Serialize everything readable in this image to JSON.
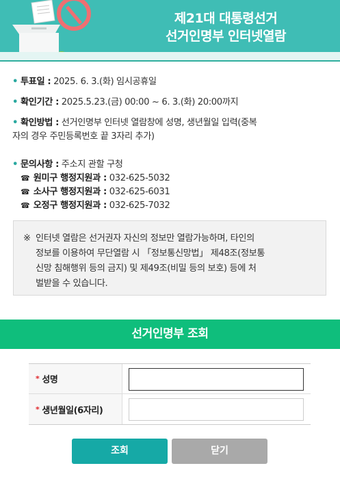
{
  "header": {
    "title_line1": "제21대 대통령선거",
    "title_line2": "선거인명부 인터넷열람",
    "colors": {
      "banner": "#3fbdb5",
      "accent": "#2aa9a0"
    }
  },
  "info": {
    "vote_day": {
      "label": "투표일 :",
      "value": "2025. 6. 3.(화) 임시공휴일"
    },
    "check_period": {
      "label": "확인기간 :",
      "value": "2025.5.23.(금) 00:00 ~ 6. 3.(화) 20:00까지"
    },
    "check_method": {
      "label": "확인방법 :",
      "value_line1": "선거인명부 인터넷 열람창에 성명, 생년월일 입력(중복",
      "value_line2": "자의 경우 주민등록번호 끝 3자리 추가)"
    },
    "inquiry": {
      "label": "문의사항 :",
      "value": "주소지 관할 구청",
      "phones": [
        {
          "icon": "telephone-icon",
          "name": "원미구 행정지원과 :",
          "number": "032-625-5032"
        },
        {
          "icon": "telephone-icon",
          "name": "소사구 행정지원과 :",
          "number": "032-625-6031"
        },
        {
          "icon": "telephone-icon",
          "name": "오정구 행정지원과 :",
          "number": "032-625-7032"
        }
      ]
    }
  },
  "notice": {
    "mark": "※",
    "line1": "인터넷 열람은 선거권자 자신의 정보만 열람가능하며, 타인의",
    "line2": "정보를 이용하여 무단열람 시 「정보통신망법」 제48조(정보통",
    "line3": "신망 침해행위 등의 금지) 및 제49조(비밀 등의 보호) 등에 처",
    "line4": "벌받을 수 있습니다."
  },
  "section": {
    "title": "선거인명부 조회",
    "color": "#0fbe7c"
  },
  "form": {
    "required_mark": "*",
    "name_label": "성명",
    "name_value": "",
    "birth_label": "생년월일(6자리)",
    "birth_value": ""
  },
  "buttons": {
    "search": "조회",
    "close": "닫기"
  }
}
